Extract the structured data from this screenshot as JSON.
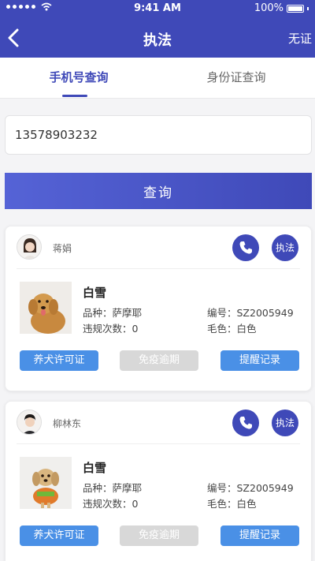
{
  "status_bar": {
    "time": "9:41 AM",
    "battery": "100%"
  },
  "nav": {
    "title": "执法",
    "right_label": "无证"
  },
  "tabs": [
    {
      "label": "手机号查询",
      "active": true
    },
    {
      "label": "身份证查询",
      "active": false
    }
  ],
  "search": {
    "phone_value": "13578903232"
  },
  "query_button_label": "查询",
  "colors": {
    "primary": "#3f49b8",
    "action_blue": "#4a90e6",
    "disabled_grey": "#d8d8d8"
  },
  "cards": [
    {
      "owner_name": "蒋娟",
      "enforce_label": "执法",
      "dog_name": "白雪",
      "breed": "品种：萨摩耶",
      "violations": "违规次数：0",
      "number": "编号：SZ2005949",
      "coat_color": "毛色：白色",
      "buttons": {
        "license": "养犬许可证",
        "vaccine": "免疫逾期",
        "reminder": "提醒记录"
      }
    },
    {
      "owner_name": "柳林东",
      "enforce_label": "执法",
      "dog_name": "白雪",
      "breed": "品种：萨摩耶",
      "violations": "违规次数：0",
      "number": "编号：SZ2005949",
      "coat_color": "毛色：白色",
      "buttons": {
        "license": "养犬许可证",
        "vaccine": "免疫逾期",
        "reminder": "提醒记录"
      }
    }
  ]
}
